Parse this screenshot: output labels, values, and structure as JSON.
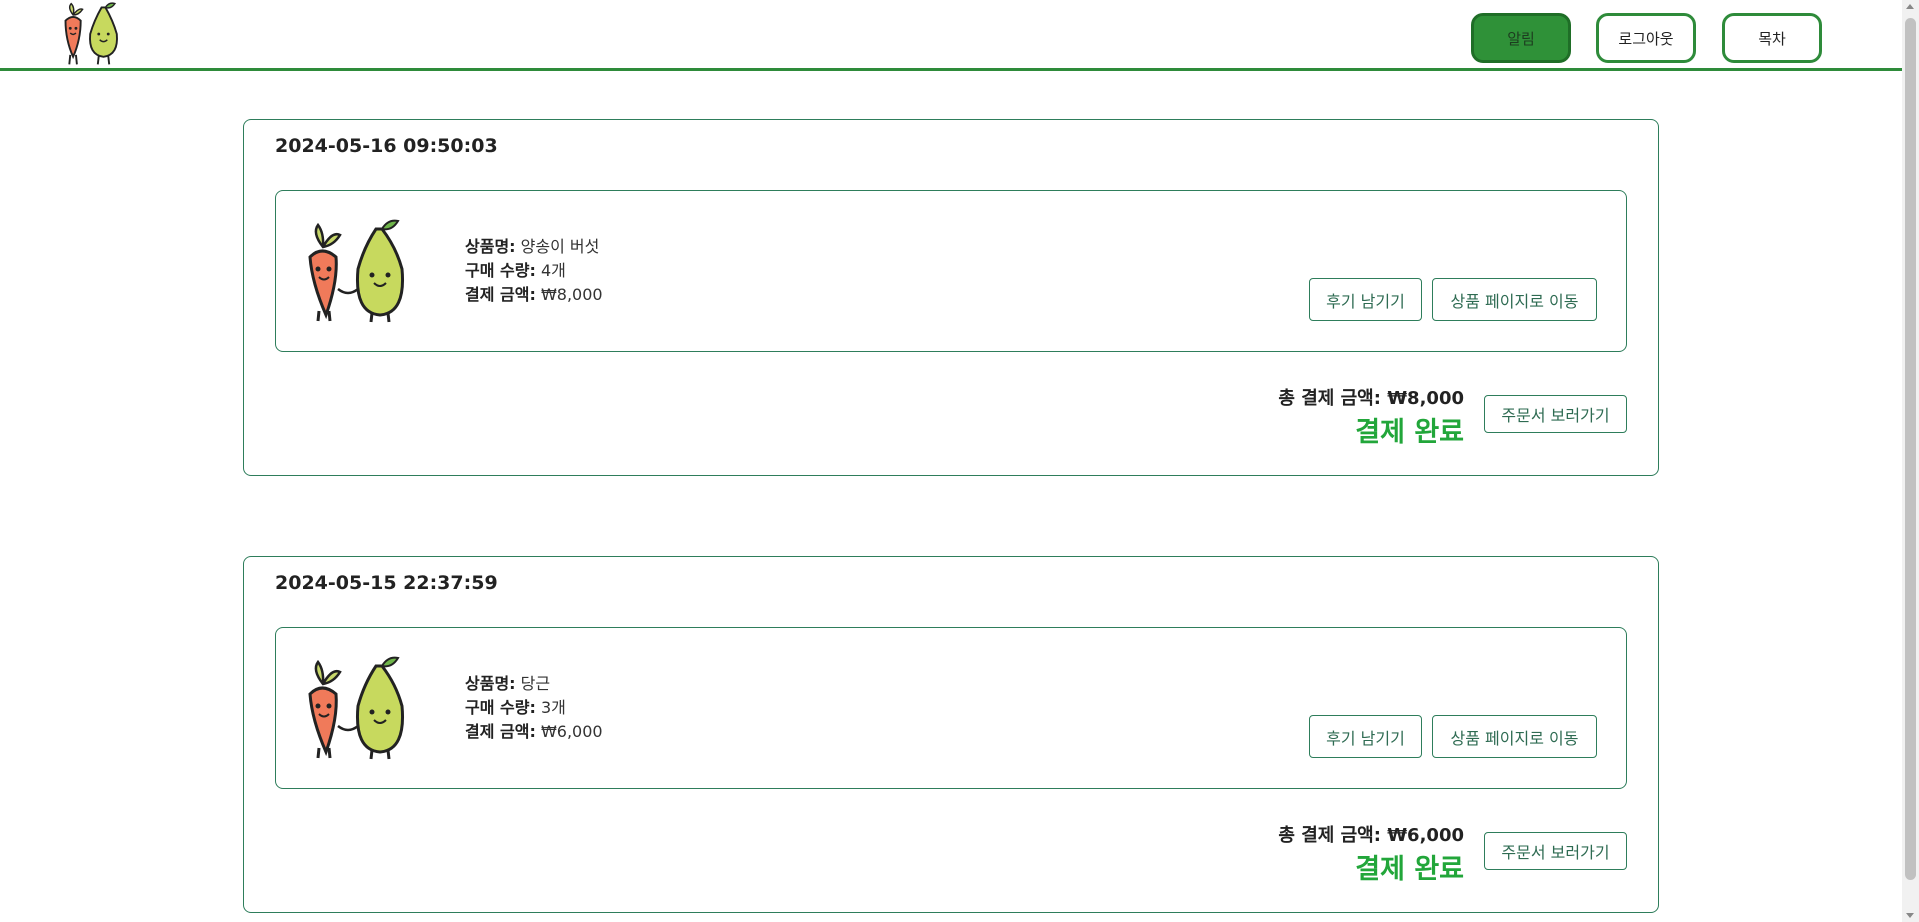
{
  "header": {
    "logo": "carrot-pear-logo",
    "nav": {
      "alarm": "알림",
      "logout": "로그아웃",
      "toc": "목차"
    }
  },
  "orders": [
    {
      "date": "2024-05-16 09:50:03",
      "item": {
        "name_label": "상품명:",
        "name": "양송이 버섯",
        "qty_label": "구매 수량:",
        "qty": "4개",
        "price_label": "결제 금액:",
        "price": "₩8,000"
      },
      "review_btn": "후기 남기기",
      "goto_btn": "상품 페이지로 이동",
      "total_label": "총 결제 금액:",
      "total": "₩8,000",
      "status": "결제 완료",
      "order_btn": "주문서 보러가기"
    },
    {
      "date": "2024-05-15 22:37:59",
      "item": {
        "name_label": "상품명:",
        "name": "당근",
        "qty_label": "구매 수량:",
        "qty": "3개",
        "price_label": "결제 금액:",
        "price": "₩6,000"
      },
      "review_btn": "후기 남기기",
      "goto_btn": "상품 페이지로 이동",
      "total_label": "총 결제 금액:",
      "total": "₩6,000",
      "status": "결제 완료",
      "order_btn": "주문서 보러가기"
    }
  ],
  "colors": {
    "brand_green": "#2e8b3a",
    "status_green": "#22a63a",
    "card_border": "#2e7d5b"
  }
}
